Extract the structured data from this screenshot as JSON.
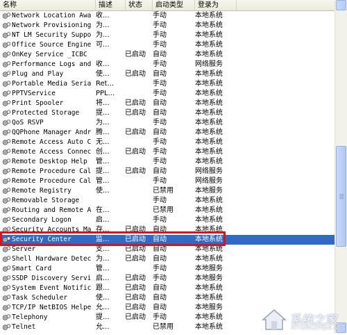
{
  "columns": {
    "name": "名称",
    "description": "描述",
    "status": "状态",
    "startup": "启动类型",
    "logon": "登录为"
  },
  "services": [
    {
      "name": "Network Location Awa...",
      "description": "收...",
      "status": "",
      "startup": "手动",
      "logon": "本地系统"
    },
    {
      "name": "Network Provisioning...",
      "description": "为...",
      "status": "",
      "startup": "手动",
      "logon": "本地系统"
    },
    {
      "name": "NT LM Security Suppo...",
      "description": "为...",
      "status": "",
      "startup": "手动",
      "logon": "本地系统"
    },
    {
      "name": "Office Source Engine",
      "description": "可...",
      "status": "",
      "startup": "手动",
      "logon": "本地系统"
    },
    {
      "name": "OnKey Service _ICBC",
      "description": "",
      "status": "已启动",
      "startup": "自动",
      "logon": "本地系统"
    },
    {
      "name": "Performance Logs and...",
      "description": "收...",
      "status": "",
      "startup": "手动",
      "logon": "网络服务"
    },
    {
      "name": "Plug and Play",
      "description": "使...",
      "status": "已启动",
      "startup": "自动",
      "logon": "本地系统"
    },
    {
      "name": "Portable Media Seria...",
      "description": "Ret...",
      "status": "",
      "startup": "手动",
      "logon": "本地系统"
    },
    {
      "name": "PPTVService",
      "description": "PPL...",
      "status": "",
      "startup": "手动",
      "logon": "本地系统"
    },
    {
      "name": "Print Spooler",
      "description": "将...",
      "status": "已启动",
      "startup": "自动",
      "logon": "本地系统"
    },
    {
      "name": "Protected Storage",
      "description": "提...",
      "status": "已启动",
      "startup": "自动",
      "logon": "本地系统"
    },
    {
      "name": "QoS RSVP",
      "description": "为...",
      "status": "",
      "startup": "手动",
      "logon": "本地系统"
    },
    {
      "name": "QQPhone Manager Andr...",
      "description": "腾...",
      "status": "已启动",
      "startup": "自动",
      "logon": "本地系统"
    },
    {
      "name": "Remote Access Auto C...",
      "description": "无...",
      "status": "",
      "startup": "手动",
      "logon": "本地系统"
    },
    {
      "name": "Remote Access Connec...",
      "description": "创...",
      "status": "已启动",
      "startup": "手动",
      "logon": "本地系统"
    },
    {
      "name": "Remote Desktop Help ...",
      "description": "管...",
      "status": "",
      "startup": "手动",
      "logon": "本地系统"
    },
    {
      "name": "Remote Procedure Cal...",
      "description": "提...",
      "status": "已启动",
      "startup": "自动",
      "logon": "网络服务"
    },
    {
      "name": "Remote Procedure Cal...",
      "description": "管...",
      "status": "",
      "startup": "手动",
      "logon": "网络服务"
    },
    {
      "name": "Remote Registry",
      "description": "使...",
      "status": "",
      "startup": "已禁用",
      "logon": "本地服务"
    },
    {
      "name": "Removable Storage",
      "description": "",
      "status": "",
      "startup": "手动",
      "logon": "本地系统"
    },
    {
      "name": "Routing and Remote A...",
      "description": "在...",
      "status": "",
      "startup": "已禁用",
      "logon": "本地系统"
    },
    {
      "name": "Secondary Logon",
      "description": "启...",
      "status": "",
      "startup": "手动",
      "logon": "本地系统"
    },
    {
      "name": "Security Accounts Ma...",
      "description": "存...",
      "status": "已启动",
      "startup": "自动",
      "logon": "本地系统"
    },
    {
      "name": "Security Center",
      "description": "监...",
      "status": "已启动",
      "startup": "自动",
      "logon": "本地系统",
      "selected": true
    },
    {
      "name": "Server",
      "description": "支...",
      "status": "已启动",
      "startup": "自动",
      "logon": "本地系统"
    },
    {
      "name": "Shell Hardware Detec...",
      "description": "为...",
      "status": "已启动",
      "startup": "自动",
      "logon": "本地系统"
    },
    {
      "name": "Smart Card",
      "description": "管...",
      "status": "",
      "startup": "手动",
      "logon": "本地服务"
    },
    {
      "name": "SSDP Discovery Service",
      "description": "启...",
      "status": "已启动",
      "startup": "手动",
      "logon": "本地服务"
    },
    {
      "name": "System Event Notific...",
      "description": "跟...",
      "status": "已启动",
      "startup": "自动",
      "logon": "本地系统"
    },
    {
      "name": "Task Scheduler",
      "description": "使...",
      "status": "已启动",
      "startup": "自动",
      "logon": "本地系统"
    },
    {
      "name": "TCP/IP NetBIOS Helper",
      "description": "允...",
      "status": "已启动",
      "startup": "自动",
      "logon": "本地服务"
    },
    {
      "name": "Telephony",
      "description": "提...",
      "status": "已启动",
      "startup": "手动",
      "logon": "本地系统"
    },
    {
      "name": "Telnet",
      "description": "允...",
      "status": "",
      "startup": "已禁用",
      "logon": "本地系统"
    }
  ],
  "icons": {
    "service": "gear-icon"
  },
  "colors": {
    "selection": "#316ac5",
    "highlight_border": "#d9121e",
    "header_bg": "#ebeadb",
    "scroll_thumb": "#b5c9f2"
  },
  "watermark": {
    "title": "系统之家",
    "subtitle": "XITONGZHIJIA.NET"
  }
}
